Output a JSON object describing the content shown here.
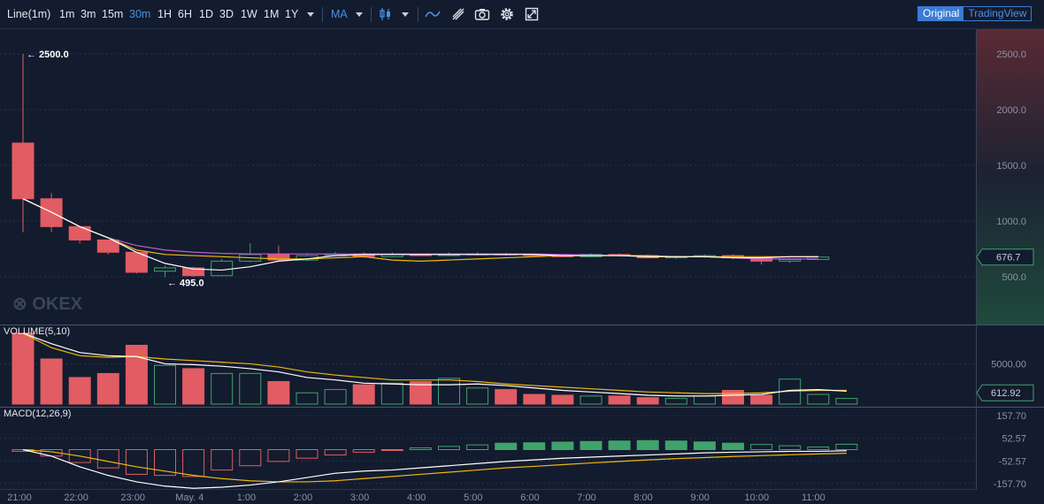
{
  "toolbar": {
    "chart_type": "Line(1m)",
    "intervals": [
      "1m",
      "3m",
      "15m",
      "30m",
      "1H",
      "6H",
      "1D",
      "3D",
      "1W",
      "1M",
      "1Y"
    ],
    "active_interval": "30m",
    "indicator": "MA",
    "views": [
      "Original",
      "TradingView"
    ],
    "active_view": "Original",
    "icons": [
      "candles-icon",
      "indicator-line-icon",
      "draw-icon",
      "camera-icon",
      "gear-icon",
      "fullscreen-icon"
    ]
  },
  "watermark": "OKEX",
  "colors": {
    "up": "#3fa36b",
    "down": "#e15c63",
    "background": "#131b2e",
    "accent": "#4a90e2",
    "ma_white": "#ffffff",
    "ma_yellow": "#f0b90b",
    "ma_purple": "#c05ad8"
  },
  "chart_data": {
    "type": "candlestick",
    "x_labels": [
      "21:00",
      "22:00",
      "23:00",
      "May. 4",
      "1:00",
      "2:00",
      "3:00",
      "4:00",
      "5:00",
      "6:00",
      "7:00",
      "8:00",
      "9:00",
      "10:00",
      "11:00"
    ],
    "price": {
      "ticks": [
        "2500.0",
        "2000.0",
        "1500.0",
        "1000.0",
        "500.0"
      ],
      "ylim": [
        400,
        2620
      ],
      "high_label": "← 2500.0",
      "low_label": "← 495.0",
      "last_price": "676.7",
      "candles": [
        {
          "o": 1700,
          "c": 1200,
          "h": 2500,
          "l": 900
        },
        {
          "o": 1200,
          "c": 950,
          "h": 1250,
          "l": 900
        },
        {
          "o": 950,
          "c": 830,
          "h": 950,
          "l": 800
        },
        {
          "o": 830,
          "c": 720,
          "h": 830,
          "l": 700
        },
        {
          "o": 720,
          "c": 540,
          "h": 720,
          "l": 530
        },
        {
          "o": 550,
          "c": 580,
          "h": 600,
          "l": 495
        },
        {
          "o": 580,
          "c": 510,
          "h": 590,
          "l": 500
        },
        {
          "o": 510,
          "c": 640,
          "h": 660,
          "l": 505
        },
        {
          "o": 640,
          "c": 700,
          "h": 800,
          "l": 630
        },
        {
          "o": 700,
          "c": 650,
          "h": 780,
          "l": 640
        },
        {
          "o": 650,
          "c": 690,
          "h": 700,
          "l": 640
        },
        {
          "o": 690,
          "c": 700,
          "h": 720,
          "l": 680
        },
        {
          "o": 700,
          "c": 680,
          "h": 720,
          "l": 670
        },
        {
          "o": 680,
          "c": 700,
          "h": 720,
          "l": 675
        },
        {
          "o": 700,
          "c": 690,
          "h": 710,
          "l": 685
        },
        {
          "o": 690,
          "c": 700,
          "h": 720,
          "l": 685
        },
        {
          "o": 700,
          "c": 705,
          "h": 720,
          "l": 690
        },
        {
          "o": 705,
          "c": 700,
          "h": 715,
          "l": 690
        },
        {
          "o": 700,
          "c": 690,
          "h": 710,
          "l": 680
        },
        {
          "o": 690,
          "c": 680,
          "h": 700,
          "l": 675
        },
        {
          "o": 680,
          "c": 700,
          "h": 710,
          "l": 675
        },
        {
          "o": 700,
          "c": 690,
          "h": 710,
          "l": 680
        },
        {
          "o": 690,
          "c": 670,
          "h": 700,
          "l": 665
        },
        {
          "o": 670,
          "c": 680,
          "h": 690,
          "l": 660
        },
        {
          "o": 680,
          "c": 690,
          "h": 700,
          "l": 670
        },
        {
          "o": 690,
          "c": 670,
          "h": 700,
          "l": 660
        },
        {
          "o": 670,
          "c": 640,
          "h": 680,
          "l": 610
        },
        {
          "o": 640,
          "c": 655,
          "h": 670,
          "l": 625
        },
        {
          "o": 655,
          "c": 676.7,
          "h": 680,
          "l": 650
        }
      ],
      "ma_white": [
        1200,
        1080,
        950,
        850,
        720,
        620,
        570,
        560,
        590,
        640,
        660,
        690,
        700,
        700,
        700,
        700,
        700,
        700,
        700,
        690,
        690,
        690,
        680,
        680,
        680,
        670,
        670,
        680,
        680
      ],
      "ma_yellow": [
        1200,
        1080,
        950,
        850,
        740,
        700,
        690,
        680,
        670,
        660,
        660,
        670,
        680,
        650,
        640,
        650,
        660,
        670,
        680,
        690,
        690,
        690,
        690,
        680,
        680,
        680,
        680,
        680,
        680
      ],
      "ma_purple": [
        1200,
        1080,
        950,
        850,
        780,
        740,
        720,
        710,
        705,
        705,
        705,
        705,
        705,
        705,
        705,
        705,
        705,
        705,
        705,
        700,
        695,
        690,
        685,
        680,
        680,
        670,
        660,
        660,
        660
      ]
    },
    "volume": {
      "label": "VOLUME(5,10)",
      "ticks": [
        "5000.00"
      ],
      "last_value": "612.92",
      "ylim": [
        0,
        9000
      ],
      "bars": [
        8800,
        5600,
        3300,
        3800,
        7300,
        4800,
        4400,
        3800,
        3800,
        2800,
        1400,
        1800,
        2400,
        2600,
        2800,
        3200,
        2000,
        1800,
        1200,
        1100,
        1000,
        1000,
        800,
        700,
        1000,
        1700,
        1100,
        3100,
        1200,
        700
      ],
      "ma_white": [
        8800,
        7500,
        6400,
        6000,
        5900,
        5000,
        4900,
        4700,
        4400,
        4000,
        3300,
        3000,
        2600,
        2500,
        2400,
        2400,
        2500,
        2300,
        2000,
        1700,
        1500,
        1300,
        1100,
        1000,
        1000,
        1100,
        1200,
        1700,
        1800,
        1600
      ],
      "ma_yellow": [
        8800,
        7000,
        6000,
        5800,
        5900,
        5600,
        5400,
        5200,
        5000,
        4600,
        4000,
        3600,
        3300,
        3000,
        3000,
        3000,
        2800,
        2500,
        2300,
        2100,
        1900,
        1700,
        1500,
        1400,
        1300,
        1300,
        1400,
        1600,
        1700,
        1700
      ]
    },
    "macd": {
      "label": "MACD(12,26,9)",
      "ticks": [
        "157.70",
        "52.57",
        "-52.57",
        "-157.70"
      ],
      "ylim": [
        -175,
        175
      ],
      "hist": [
        -8,
        -30,
        -60,
        -85,
        -115,
        -120,
        -125,
        -95,
        -75,
        -55,
        -40,
        -25,
        -12,
        -3,
        8,
        15,
        22,
        30,
        32,
        35,
        38,
        40,
        42,
        40,
        36,
        30,
        24,
        18,
        12,
        25
      ],
      "dif": [
        0,
        -30,
        -80,
        -120,
        -150,
        -170,
        -180,
        -175,
        -165,
        -150,
        -130,
        -110,
        -100,
        -95,
        -85,
        -75,
        -65,
        -55,
        -48,
        -40,
        -35,
        -30,
        -25,
        -20,
        -15,
        -12,
        -10,
        -8,
        -8,
        -5
      ],
      "dea": [
        0,
        -10,
        -30,
        -55,
        -80,
        -100,
        -120,
        -135,
        -145,
        -150,
        -150,
        -145,
        -135,
        -125,
        -115,
        -105,
        -95,
        -85,
        -78,
        -70,
        -62,
        -55,
        -48,
        -42,
        -37,
        -32,
        -28,
        -24,
        -20,
        -17
      ]
    }
  }
}
